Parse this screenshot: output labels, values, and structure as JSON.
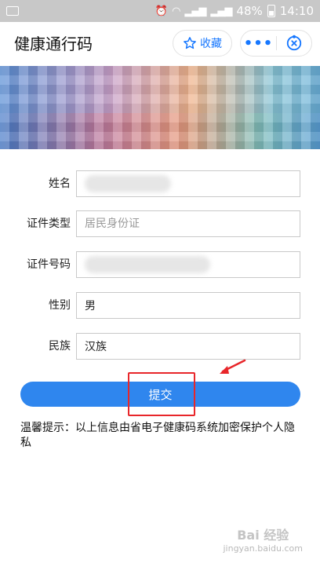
{
  "status_bar": {
    "battery": "48%",
    "time": "14:10"
  },
  "header": {
    "title": "健康通行码",
    "favorite_label": "收藏",
    "more_label": "•••"
  },
  "form": {
    "fields": [
      {
        "label": "姓名",
        "value": "",
        "placeholder": ""
      },
      {
        "label": "证件类型",
        "value": "",
        "placeholder": "居民身份证"
      },
      {
        "label": "证件号码",
        "value": "",
        "placeholder": ""
      },
      {
        "label": "性别",
        "value": "男",
        "placeholder": ""
      },
      {
        "label": "民族",
        "value": "汉族",
        "placeholder": ""
      }
    ],
    "submit_label": "提交"
  },
  "tip": "温馨提示：以上信息由省电子健康码系统加密保护个人隐私",
  "watermark": {
    "main": "Bai 经验",
    "sub": "jingyan.baidu.com"
  },
  "colors": {
    "accent": "#2f86ee",
    "annotation": "#e8262a"
  }
}
